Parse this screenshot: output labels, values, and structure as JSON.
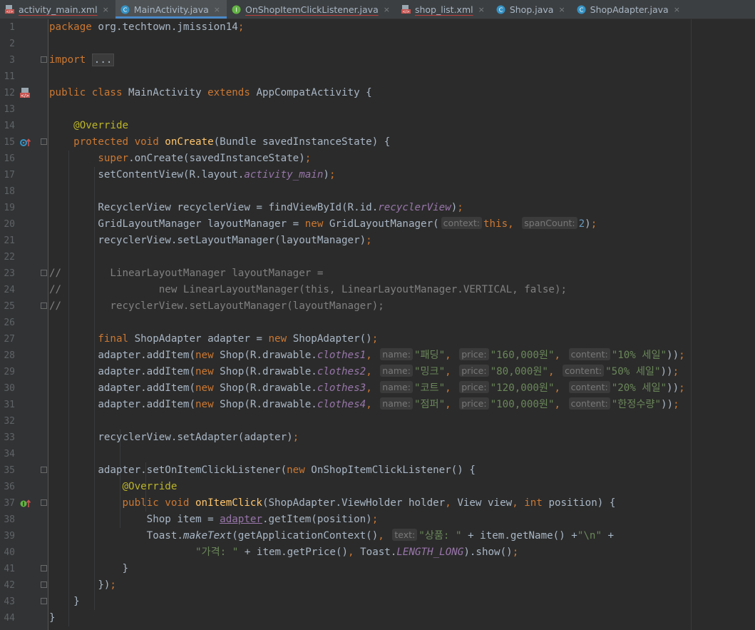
{
  "tabs": [
    {
      "label": "activity_main.xml",
      "icon": "xml-layout-icon",
      "active": false
    },
    {
      "label": "MainActivity.java",
      "icon": "java-class-icon",
      "active": true
    },
    {
      "label": "OnShopItemClickListener.java",
      "icon": "java-interface-icon",
      "active": false
    },
    {
      "label": "shop_list.xml",
      "icon": "xml-layout-icon",
      "active": false
    },
    {
      "label": "Shop.java",
      "icon": "java-class-icon",
      "active": false
    },
    {
      "label": "ShopAdapter.java",
      "icon": "java-class-icon",
      "active": false
    }
  ],
  "tab_close_glyph": "×",
  "colors": {
    "keyword": "#cc7832",
    "annotation": "#bbb529",
    "method_decl": "#ffc66d",
    "string": "#6a8759",
    "field": "#9876aa",
    "comment": "#808080",
    "number": "#6897bb",
    "text": "#a9b7c6",
    "background": "#2b2b2b",
    "gutter": "#313335"
  },
  "lines": [
    {
      "n": "1",
      "seg": [
        [
          "k",
          "package "
        ],
        [
          "",
          "org.techtown.jmission14"
        ],
        [
          "k",
          ";"
        ]
      ]
    },
    {
      "n": "2",
      "seg": []
    },
    {
      "n": "3",
      "seg": [
        [
          "k",
          "import "
        ],
        [
          "box",
          "..."
        ]
      ]
    },
    {
      "n": "11",
      "seg": []
    },
    {
      "n": "12",
      "seg": [
        [
          "k",
          "public class "
        ],
        [
          "",
          "MainActivity "
        ],
        [
          "k",
          "extends "
        ],
        [
          "",
          "AppCompatActivity {"
        ]
      ]
    },
    {
      "n": "13",
      "seg": []
    },
    {
      "n": "14",
      "seg": [
        [
          "",
          "    "
        ],
        [
          "a",
          "@Override"
        ]
      ]
    },
    {
      "n": "15",
      "seg": [
        [
          "",
          "    "
        ],
        [
          "k",
          "protected void "
        ],
        [
          "f",
          "onCreate"
        ],
        [
          "",
          "(Bundle savedInstanceState) {"
        ]
      ]
    },
    {
      "n": "16",
      "seg": [
        [
          "",
          "        "
        ],
        [
          "k",
          "super"
        ],
        [
          "",
          ".onCreate(savedInstanceState)"
        ],
        [
          "k",
          ";"
        ]
      ]
    },
    {
      "n": "17",
      "seg": [
        [
          "",
          "        setContentView(R.layout."
        ],
        [
          "i",
          "activity_main"
        ],
        [
          "",
          ")"
        ],
        [
          "k",
          ";"
        ]
      ]
    },
    {
      "n": "18",
      "seg": []
    },
    {
      "n": "19",
      "seg": [
        [
          "",
          "        RecyclerView recyclerView = findViewById(R.id."
        ],
        [
          "i",
          "recyclerView"
        ],
        [
          "",
          ")"
        ],
        [
          "k",
          ";"
        ]
      ]
    },
    {
      "n": "20",
      "seg": [
        [
          "",
          "        GridLayoutManager layoutManager = "
        ],
        [
          "k",
          "new "
        ],
        [
          "",
          "GridLayoutManager("
        ],
        [
          "hint",
          "context:"
        ],
        [
          "k",
          "this, "
        ],
        [
          "hint",
          "spanCount:"
        ],
        [
          "n",
          "2"
        ],
        [
          "",
          ")"
        ],
        [
          "k",
          ";"
        ]
      ]
    },
    {
      "n": "21",
      "seg": [
        [
          "",
          "        recyclerView.setLayoutManager(layoutManager)"
        ],
        [
          "k",
          ";"
        ]
      ]
    },
    {
      "n": "22",
      "seg": []
    },
    {
      "n": "23",
      "seg": [
        [
          "c",
          "//        LinearLayoutManager layoutManager ="
        ]
      ]
    },
    {
      "n": "24",
      "seg": [
        [
          "c",
          "//                new LinearLayoutManager(this, LinearLayoutManager.VERTICAL, false);"
        ]
      ]
    },
    {
      "n": "25",
      "seg": [
        [
          "c",
          "//        recyclerView.setLayoutManager(layoutManager);"
        ]
      ]
    },
    {
      "n": "26",
      "seg": []
    },
    {
      "n": "27",
      "seg": [
        [
          "",
          "        "
        ],
        [
          "k",
          "final "
        ],
        [
          "",
          "ShopAdapter adapter = "
        ],
        [
          "k",
          "new "
        ],
        [
          "",
          "ShopAdapter()"
        ],
        [
          "k",
          ";"
        ]
      ]
    },
    {
      "n": "28",
      "seg": [
        [
          "",
          "        adapter.addItem("
        ],
        [
          "k",
          "new "
        ],
        [
          "",
          "Shop(R.drawable."
        ],
        [
          "i",
          "clothes1"
        ],
        [
          "k",
          ", "
        ],
        [
          "hint",
          "name:"
        ],
        [
          "s",
          "\"패딩\""
        ],
        [
          "k",
          ", "
        ],
        [
          "hint",
          "price:"
        ],
        [
          "s",
          "\"160,000원\""
        ],
        [
          "k",
          ", "
        ],
        [
          "hint",
          "content:"
        ],
        [
          "s",
          "\"10% 세일\""
        ],
        [
          "",
          "))"
        ],
        [
          "k",
          ";"
        ]
      ]
    },
    {
      "n": "29",
      "seg": [
        [
          "",
          "        adapter.addItem("
        ],
        [
          "k",
          "new "
        ],
        [
          "",
          "Shop(R.drawable."
        ],
        [
          "i",
          "clothes2"
        ],
        [
          "k",
          ", "
        ],
        [
          "hint",
          "name:"
        ],
        [
          "s",
          "\"밍크\""
        ],
        [
          "k",
          ", "
        ],
        [
          "hint",
          "price:"
        ],
        [
          "s",
          "\"80,000원\""
        ],
        [
          "k",
          ", "
        ],
        [
          "hint",
          "content:"
        ],
        [
          "s",
          "\"50% 세일\""
        ],
        [
          "",
          "))"
        ],
        [
          "k",
          ";"
        ]
      ]
    },
    {
      "n": "30",
      "seg": [
        [
          "",
          "        adapter.addItem("
        ],
        [
          "k",
          "new "
        ],
        [
          "",
          "Shop(R.drawable."
        ],
        [
          "i",
          "clothes3"
        ],
        [
          "k",
          ", "
        ],
        [
          "hint",
          "name:"
        ],
        [
          "s",
          "\"코트\""
        ],
        [
          "k",
          ", "
        ],
        [
          "hint",
          "price:"
        ],
        [
          "s",
          "\"120,000원\""
        ],
        [
          "k",
          ", "
        ],
        [
          "hint",
          "content:"
        ],
        [
          "s",
          "\"20% 세일\""
        ],
        [
          "",
          "))"
        ],
        [
          "k",
          ";"
        ]
      ]
    },
    {
      "n": "31",
      "seg": [
        [
          "",
          "        adapter.addItem("
        ],
        [
          "k",
          "new "
        ],
        [
          "",
          "Shop(R.drawable."
        ],
        [
          "i",
          "clothes4"
        ],
        [
          "k",
          ", "
        ],
        [
          "hint",
          "name:"
        ],
        [
          "s",
          "\"점퍼\""
        ],
        [
          "k",
          ", "
        ],
        [
          "hint",
          "price:"
        ],
        [
          "s",
          "\"100,000원\""
        ],
        [
          "k",
          ", "
        ],
        [
          "hint",
          "content:"
        ],
        [
          "s",
          "\"한정수량\""
        ],
        [
          "",
          "))"
        ],
        [
          "k",
          ";"
        ]
      ]
    },
    {
      "n": "32",
      "seg": []
    },
    {
      "n": "33",
      "seg": [
        [
          "",
          "        recyclerView.setAdapter(adapter)"
        ],
        [
          "k",
          ";"
        ]
      ]
    },
    {
      "n": "34",
      "seg": []
    },
    {
      "n": "35",
      "seg": [
        [
          "",
          "        adapter.setOnItemClickListener("
        ],
        [
          "k",
          "new "
        ],
        [
          "",
          "OnShopItemClickListener() {"
        ]
      ]
    },
    {
      "n": "36",
      "seg": [
        [
          "",
          "            "
        ],
        [
          "a",
          "@Override"
        ]
      ]
    },
    {
      "n": "37",
      "seg": [
        [
          "",
          "            "
        ],
        [
          "k",
          "public void "
        ],
        [
          "f",
          "onItemClick"
        ],
        [
          "",
          "(ShopAdapter.ViewHolder holder"
        ],
        [
          "k",
          ", "
        ],
        [
          "",
          "View view"
        ],
        [
          "k",
          ", int "
        ],
        [
          "",
          "position) {"
        ]
      ]
    },
    {
      "n": "38",
      "seg": [
        [
          "",
          "                Shop item = "
        ],
        [
          "u",
          "adapter"
        ],
        [
          "",
          ".getItem(position)"
        ],
        [
          "k",
          ";"
        ]
      ]
    },
    {
      "n": "39",
      "seg": [
        [
          "",
          "                Toast."
        ],
        [
          "m",
          "makeText"
        ],
        [
          "",
          "(getApplicationContext()"
        ],
        [
          "k",
          ", "
        ],
        [
          "hint",
          "text:"
        ],
        [
          "s",
          "\"상품: \""
        ],
        [
          "",
          " + item.getName() +"
        ],
        [
          "s",
          "\"\\n\""
        ],
        [
          "",
          " +"
        ]
      ]
    },
    {
      "n": "40",
      "seg": [
        [
          "",
          "                        "
        ],
        [
          "s",
          "\"가격: \""
        ],
        [
          "",
          " + item.getPrice()"
        ],
        [
          "k",
          ", "
        ],
        [
          "",
          "Toast."
        ],
        [
          "i",
          "LENGTH_LONG"
        ],
        [
          "",
          ").show()"
        ],
        [
          "k",
          ";"
        ]
      ]
    },
    {
      "n": "41",
      "seg": [
        [
          "",
          "            }"
        ]
      ]
    },
    {
      "n": "42",
      "seg": [
        [
          "",
          "        })"
        ],
        [
          "k",
          ";"
        ]
      ]
    },
    {
      "n": "43",
      "seg": [
        [
          "",
          "    }"
        ]
      ]
    },
    {
      "n": "44",
      "seg": [
        [
          "",
          "}"
        ]
      ]
    }
  ]
}
